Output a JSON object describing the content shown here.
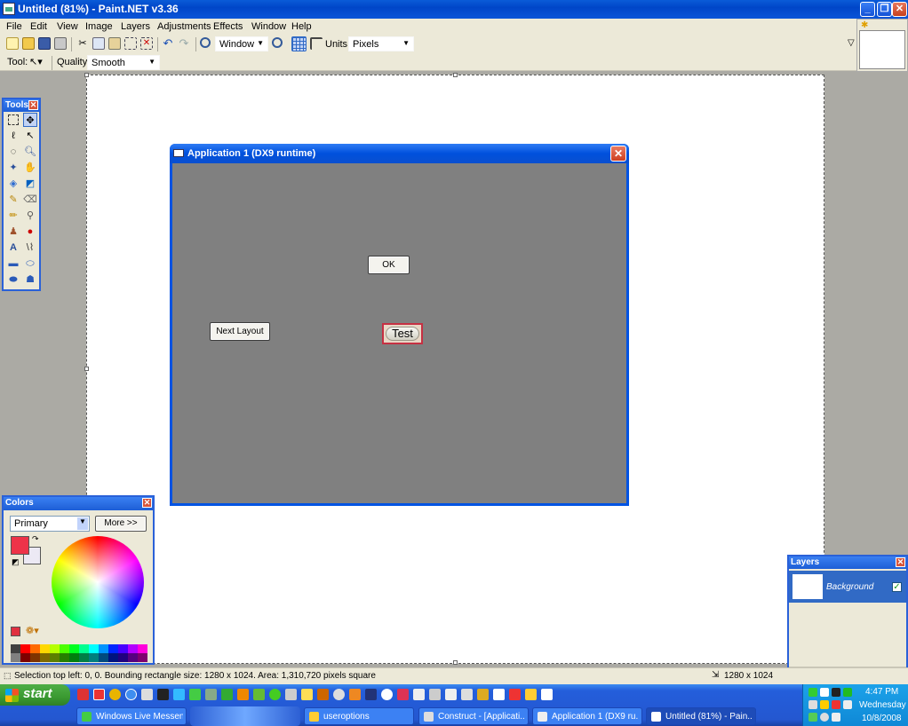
{
  "window": {
    "title": "Untitled (81%) - Paint.NET v3.36"
  },
  "menu": [
    "File",
    "Edit",
    "View",
    "Image",
    "Layers",
    "Adjustments",
    "Effects",
    "Window",
    "Help"
  ],
  "toolbar": {
    "zoom_mode": "Window",
    "units_label": "Units:",
    "units_value": "Pixels",
    "tool_label": "Tool:",
    "quality_label": "Quality:",
    "quality_value": "Smooth"
  },
  "tools_panel": {
    "title": "Tools"
  },
  "app_window": {
    "title": "Application 1 (DX9 runtime)",
    "ok_label": "OK",
    "next_layout_label": "Next Layout",
    "test_label": "Test"
  },
  "colors_panel": {
    "title": "Colors",
    "mode_value": "Primary",
    "more_label": "More >>",
    "primary_color": "#ee3349",
    "secondary_color": "#ece9f4",
    "palette": [
      "#404040",
      "#ff0000",
      "#ff6a00",
      "#ffd800",
      "#b6ff00",
      "#4cff00",
      "#00ff21",
      "#00ff90",
      "#00ffff",
      "#0094ff",
      "#0026ff",
      "#4800ff",
      "#b200ff",
      "#ff00dc",
      "#808080",
      "#7f0000",
      "#7f3300",
      "#7f6a00",
      "#5b7f00",
      "#267f00",
      "#007f0e",
      "#007f46",
      "#007f7f",
      "#004a7f",
      "#00137f",
      "#21007f",
      "#57007f",
      "#7f006e"
    ]
  },
  "layers_panel": {
    "title": "Layers",
    "layer_name": "Background"
  },
  "status": {
    "text": "Selection top left: 0, 0. Bounding rectangle size: 1280 x 1024. Area: 1,310,720 pixels square",
    "image_size": "1280 x 1024"
  },
  "taskbar": {
    "start_label": "start",
    "tasks": [
      "Windows Live Messen...",
      "useroptions",
      "Construct - [Applicati...",
      "Application 1 (DX9 ru...",
      "Untitled (81%) - Pain..."
    ],
    "clock_time": "4:47 PM",
    "clock_day": "Wednesday",
    "clock_date": "10/8/2008"
  }
}
